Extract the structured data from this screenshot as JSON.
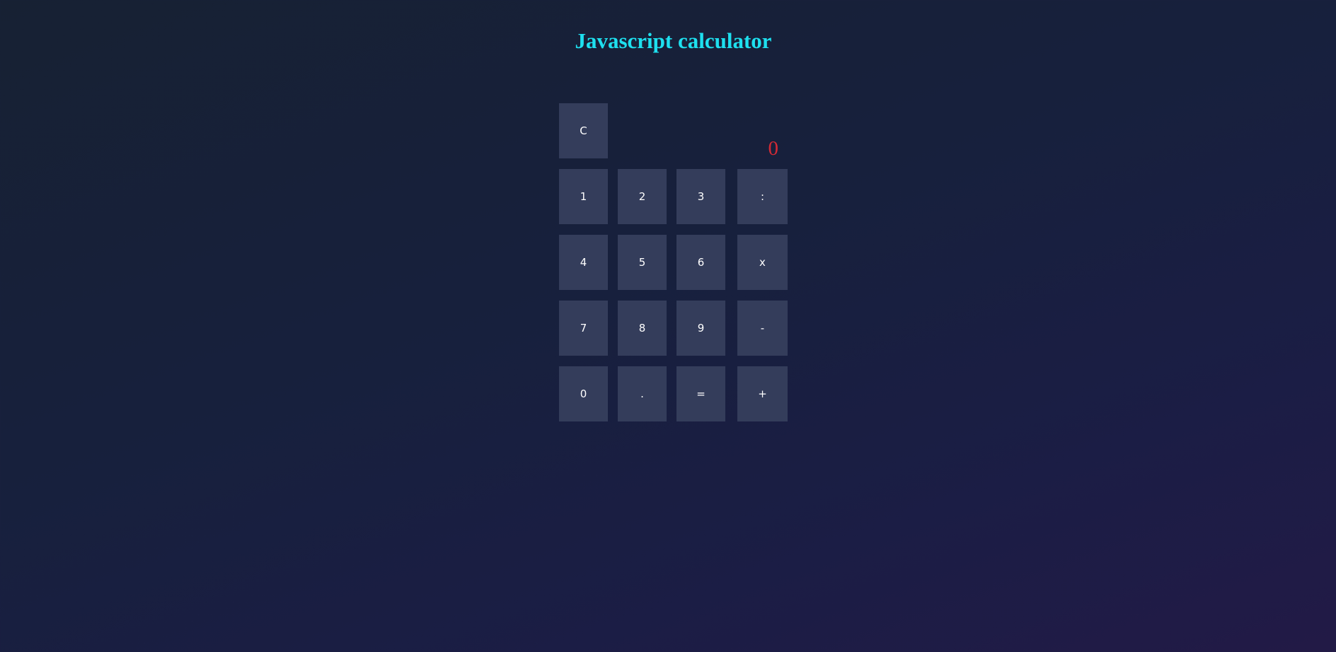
{
  "page": {
    "title": "Javascript calculator"
  },
  "calculator": {
    "display": "0",
    "clear_label": "C",
    "keys": {
      "one": "1",
      "two": "2",
      "three": "3",
      "divide": ":",
      "four": "4",
      "five": "5",
      "six": "6",
      "multiply": "x",
      "seven": "7",
      "eight": "8",
      "nine": "9",
      "subtract": "-",
      "zero": "0",
      "decimal": ".",
      "equals": "=",
      "add": "+"
    }
  },
  "colors": {
    "title": "#1ee0ef",
    "display_text": "#d32a35",
    "button_bg": "#343d5b",
    "button_text": "#ffffff",
    "background_start": "#172133",
    "background_end": "#221a46"
  }
}
